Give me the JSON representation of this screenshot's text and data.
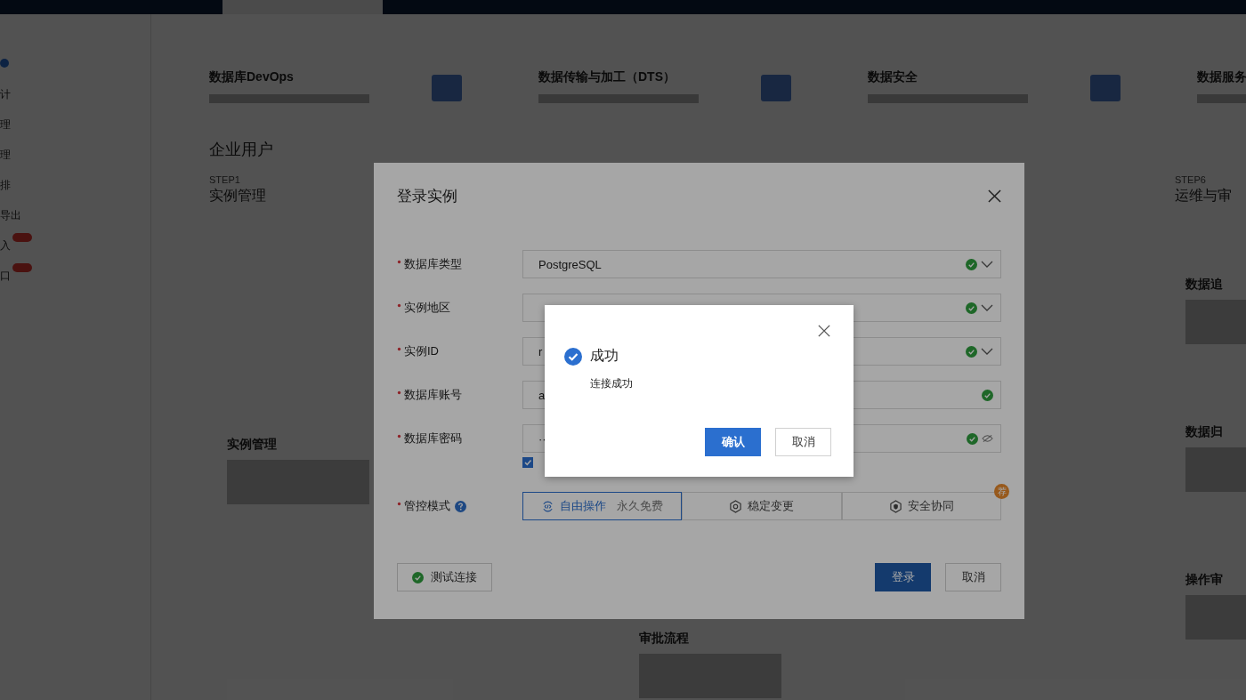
{
  "sidebar": {
    "items": [
      {
        "label": "计",
        "hot": false
      },
      {
        "label": "理",
        "hot": false
      },
      {
        "label": "理",
        "hot": false
      },
      {
        "label": "排",
        "hot": false
      },
      {
        "label": "导出",
        "hot": false
      },
      {
        "label": "入",
        "hot": true
      },
      {
        "label": "口",
        "hot": true
      }
    ]
  },
  "products": [
    {
      "title": "数据库DevOps"
    },
    {
      "title": "数据传输与加工（DTS）"
    },
    {
      "title": "数据安全"
    },
    {
      "title": "数据服务"
    }
  ],
  "section_title": "企业用户",
  "steps": [
    {
      "step": "STEP1",
      "title": "实例管理"
    },
    {
      "step": "STEP6",
      "title": "运维与审"
    }
  ],
  "feature_cards": [
    {
      "title": "实例管理"
    },
    {
      "title": "审批流程"
    },
    {
      "title": "数据追"
    },
    {
      "title": "数据归"
    },
    {
      "title": "操作审"
    }
  ],
  "login_dialog": {
    "title": "登录实例",
    "fields": [
      {
        "label": "数据库类型",
        "kind": "select",
        "value": "PostgreSQL",
        "required": true,
        "valid": true
      },
      {
        "label": "实例地区",
        "kind": "select",
        "required": true,
        "valid": true
      },
      {
        "label": "实例ID",
        "kind": "select",
        "value": "r",
        "required": true,
        "valid": true
      },
      {
        "label": "数据库账号",
        "kind": "input",
        "value": "a",
        "required": true,
        "valid": true
      },
      {
        "label": "数据库密码",
        "kind": "password",
        "value": "··",
        "required": true,
        "valid": true
      }
    ],
    "remember": {
      "checked": true
    },
    "mode": {
      "label": "管控模式",
      "required": true,
      "options": [
        {
          "label": "自由操作",
          "note": "永久免费",
          "selected": true,
          "kind": "code"
        },
        {
          "label": "稳定变更",
          "selected": false,
          "kind": "gear"
        },
        {
          "label": "安全协同",
          "selected": false,
          "kind": "shield",
          "badge": "荐"
        }
      ]
    },
    "test_button": "测试连接",
    "test_ok": true,
    "login_button": "登录",
    "cancel_button": "取消"
  },
  "success_dialog": {
    "title": "成功",
    "message": "连接成功",
    "confirm_button": "确认",
    "cancel_button": "取消"
  }
}
